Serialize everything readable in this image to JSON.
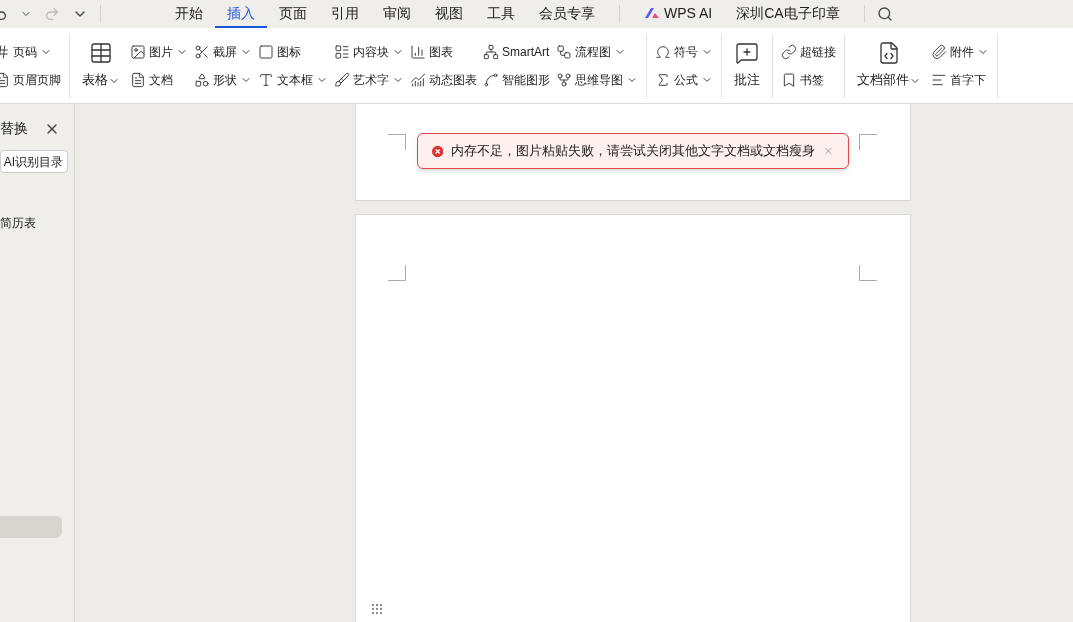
{
  "quick_access": {
    "items": [
      {
        "kind": "undo",
        "disabled": false
      },
      {
        "kind": "caret",
        "disabled": false
      },
      {
        "kind": "redo",
        "disabled": true
      },
      {
        "kind": "more",
        "disabled": false
      }
    ]
  },
  "tabs": [
    {
      "label": "开始",
      "selected": false
    },
    {
      "label": "插入",
      "selected": true
    },
    {
      "label": "页面",
      "selected": false
    },
    {
      "label": "引用",
      "selected": false
    },
    {
      "label": "审阅",
      "selected": false
    },
    {
      "label": "视图",
      "selected": false
    },
    {
      "label": "工具",
      "selected": false
    },
    {
      "label": "会员专享",
      "selected": false
    },
    {
      "label": "WPS AI",
      "selected": false,
      "kind": "ai"
    },
    {
      "label": "深圳CA电子印章",
      "selected": false
    }
  ],
  "ribbon": {
    "groups": [
      {
        "columns": [
          {
            "kind": "small",
            "items": [
              {
                "label": "页码",
                "dropdown": true
              },
              {
                "label": "页眉页脚",
                "dropdown": false
              }
            ]
          }
        ]
      },
      {
        "columns": [
          {
            "kind": "large",
            "items": [
              {
                "label": "表格",
                "dropdown": true
              }
            ]
          },
          {
            "kind": "small",
            "items": [
              {
                "label": "图片",
                "dropdown": true
              },
              {
                "label": "文档",
                "dropdown": false
              }
            ]
          },
          {
            "kind": "small",
            "items": [
              {
                "label": "截屏",
                "dropdown": true
              },
              {
                "label": "形状",
                "dropdown": true
              }
            ]
          },
          {
            "kind": "small",
            "items": [
              {
                "label": "图标",
                "dropdown": false
              },
              {
                "label": "文本框",
                "dropdown": true
              }
            ]
          },
          {
            "kind": "small",
            "items": [
              {
                "label": "内容块",
                "dropdown": true
              },
              {
                "label": "艺术字",
                "dropdown": true
              }
            ]
          },
          {
            "kind": "small",
            "items": [
              {
                "label": "图表",
                "dropdown": false
              },
              {
                "label": "动态图表",
                "dropdown": false
              }
            ]
          },
          {
            "kind": "small",
            "items": [
              {
                "label": "SmartArt",
                "dropdown": false
              },
              {
                "label": "智能图形",
                "dropdown": false
              }
            ]
          },
          {
            "kind": "small",
            "items": [
              {
                "label": "流程图",
                "dropdown": true
              },
              {
                "label": "思维导图",
                "dropdown": true
              }
            ]
          }
        ]
      },
      {
        "columns": [
          {
            "kind": "small",
            "items": [
              {
                "label": "符号",
                "dropdown": true
              },
              {
                "label": "公式",
                "dropdown": true
              }
            ]
          }
        ]
      },
      {
        "columns": [
          {
            "kind": "large",
            "items": [
              {
                "label": "批注",
                "dropdown": false
              }
            ]
          }
        ]
      },
      {
        "columns": [
          {
            "kind": "small",
            "items": [
              {
                "label": "超链接",
                "dropdown": false
              },
              {
                "label": "书签",
                "dropdown": false
              }
            ]
          }
        ]
      },
      {
        "columns": [
          {
            "kind": "large",
            "items": [
              {
                "label": "文档部件",
                "dropdown": true
              }
            ]
          },
          {
            "kind": "small",
            "items": [
              {
                "label": "附件",
                "dropdown": true
              },
              {
                "label": "首字下",
                "dropdown": false
              }
            ]
          }
        ]
      }
    ]
  },
  "side_panel": {
    "title": "替换",
    "button": "AI识别目录",
    "item": "简历表"
  },
  "toast": {
    "message": "内存不足，图片粘贴失败，请尝试关闭其他文字文档或文档瘦身"
  }
}
